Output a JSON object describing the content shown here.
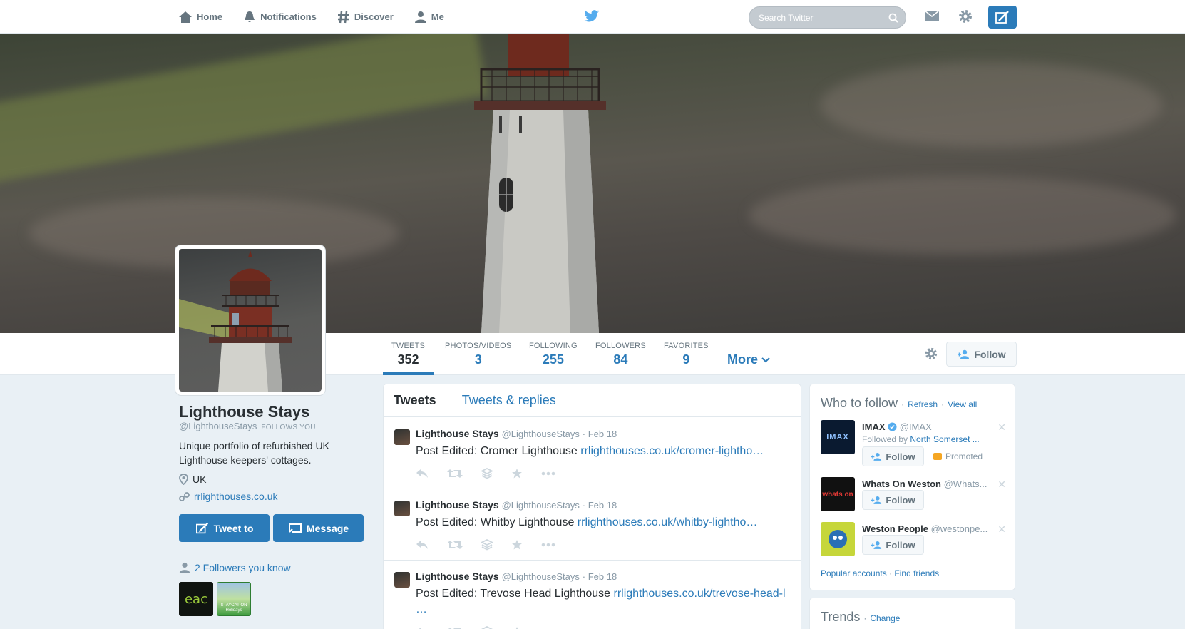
{
  "nav": {
    "home": "Home",
    "notifications": "Notifications",
    "discover": "Discover",
    "me": "Me",
    "search_placeholder": "Search Twitter"
  },
  "stats": [
    {
      "label": "TWEETS",
      "value": "352"
    },
    {
      "label": "PHOTOS/VIDEOS",
      "value": "3"
    },
    {
      "label": "FOLLOWING",
      "value": "255"
    },
    {
      "label": "FOLLOWERS",
      "value": "84"
    },
    {
      "label": "FAVORITES",
      "value": "9"
    }
  ],
  "more_label": "More",
  "follow_label": "Follow",
  "profile": {
    "name": "Lighthouse Stays",
    "handle": "@LighthouseStays",
    "follows_you": "FOLLOWS YOU",
    "bio": "Unique portfolio of refurbished UK Lighthouse keepers' cottages.",
    "location": "UK",
    "url": "rrlighthouses.co.uk",
    "tweet_to": "Tweet to",
    "message": "Message",
    "followers_you_know": "2 Followers you know",
    "known": [
      "eac",
      "STAYCATION Holidays"
    ]
  },
  "timeline": {
    "tabs": [
      "Tweets",
      "Tweets & replies"
    ],
    "tweets": [
      {
        "name": "Lighthouse Stays",
        "handle": "@LighthouseStays",
        "date": "· Feb 18",
        "text": "Post Edited: Cromer Lighthouse ",
        "link": "rrlighthouses.co.uk/cromer-lightho…"
      },
      {
        "name": "Lighthouse Stays",
        "handle": "@LighthouseStays",
        "date": "· Feb 18",
        "text": "Post Edited: Whitby Lighthouse ",
        "link": "rrlighthouses.co.uk/whitby-lightho…"
      },
      {
        "name": "Lighthouse Stays",
        "handle": "@LighthouseStays",
        "date": "· Feb 18",
        "text": "Post Edited: Trevose Head Lighthouse ",
        "link": "rrlighthouses.co.uk/trevose-head-l …"
      }
    ]
  },
  "who_to_follow": {
    "title": "Who to follow",
    "refresh": "Refresh",
    "view_all": "View all",
    "dot": "·",
    "suggestions": [
      {
        "name": "IMAX",
        "handle": "@IMAX",
        "sub_prefix": "Followed by ",
        "sub_link": "North Somerset ...",
        "follow": "Follow",
        "promoted": "Promoted",
        "avatar_text": "IMAX"
      },
      {
        "name": "Whats On Weston",
        "handle": "@Whats...",
        "follow": "Follow",
        "avatar_text": "whats on"
      },
      {
        "name": "Weston People",
        "handle": "@westonpe...",
        "follow": "Follow"
      }
    ],
    "popular": "Popular accounts",
    "find_friends": "Find friends"
  },
  "trends": {
    "title": "Trends",
    "change": "Change"
  },
  "colors": {
    "accent": "#2b7bb9",
    "background": "#e9f0f5"
  }
}
